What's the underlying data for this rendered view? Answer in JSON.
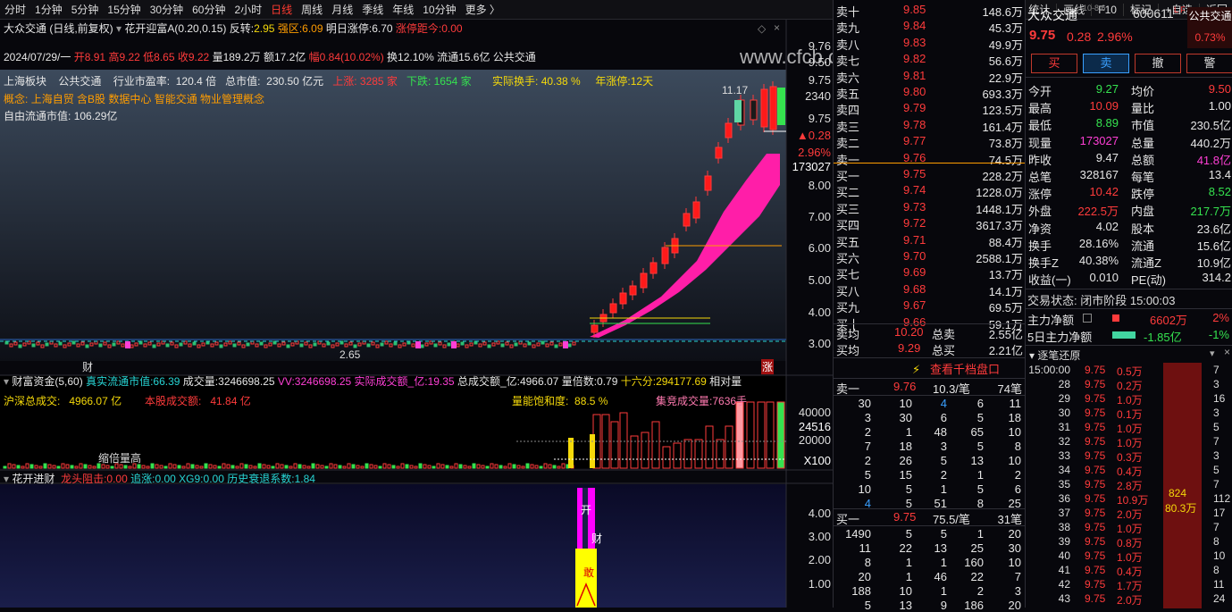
{
  "toolbar": {
    "periods": [
      "分时",
      "1分钟",
      "5分钟",
      "15分钟",
      "30分钟",
      "60分钟",
      "2小时",
      "日线",
      "周线",
      "月线",
      "季线",
      "年线",
      "10分钟",
      "更多 〉"
    ],
    "active_period": "日线",
    "right": [
      "复权",
      "叠加",
      "多股",
      "统计",
      "画线",
      "F10",
      "标记",
      "+自选",
      "返回"
    ]
  },
  "chart": {
    "title": "大众交通 (日线,前复权)",
    "indicator": "花开迎富A(0.20,0.15)",
    "fanzhuan_label": "反转:",
    "fanzhuan": "2.95",
    "qiangqu_label": "强区:",
    "qiangqu": "6.09",
    "mingri_label": "明日涨停:",
    "mingri": "6.70",
    "juli_label": "涨停距今:",
    "juli": "0.00",
    "date": "2024/07/29/一",
    "kai": "开8.91",
    "gao": "高9.22",
    "di": "低8.65",
    "shou": "收9.22",
    "liang": "量189.2万",
    "e": "额17.2亿",
    "fu": "幅0.84(10.02%)",
    "huan": "换12.10%",
    "liutong": "流通15.6亿",
    "name_tag": "公共交通",
    "board": "上海板块",
    "industry": "公共交通",
    "pe_label": "行业市盈率:",
    "pe": "120.4 倍",
    "mcap_label": "总市值:",
    "mcap": "230.50 亿元",
    "up_label": "上涨:",
    "up": "3285 家",
    "down_label": "下跌:",
    "down": "1654 家",
    "turn_label": "实际换手:",
    "turn": "40.38 %",
    "nian_label": "年涨停:",
    "nian": "12天",
    "concept_label": "概念:",
    "concepts": "上海自贸  含B股  数据中心  智能交通  物业管理概念",
    "free_label": "自由流通市值:",
    "free": "106.29亿",
    "watermark": "www.cfcb.com",
    "yticks": [
      "9.76",
      "9.50",
      "9.75",
      "2340",
      "9.75",
      "▲0.28",
      "2.96%",
      "173027",
      "8.00",
      "7.00",
      "6.00",
      "5.00",
      "4.00",
      "3.00"
    ],
    "high_label": "11.17",
    "low_label": "2.65",
    "cai": "财",
    "zhang": "涨"
  },
  "vol": {
    "title": "财富资金(5,60)",
    "zhenshi_label": "真实流通市值:",
    "zhenshi": "66.39",
    "cjl_label": "成交量:",
    "cjl": "3246698.25",
    "vv_label": "VV:",
    "vv": "3246698.25",
    "sjcje_label": "实际成交额_亿:",
    "sjcje": "19.35",
    "zcje_label": "总成交额_亿:",
    "zcje": "4966.07",
    "lbs_label": "量倍数:",
    "lbs": "0.79",
    "sl_label": "十六分:",
    "sl": "294177.69",
    "xd_label": "相对量",
    "hs_label": "沪深总成交:",
    "hs": "4966.07 亿",
    "bg_label": "本股成交额:",
    "bg": "41.84 亿",
    "bh_label": "量能饱和度:",
    "bh": "88.5 %",
    "jj_label": "集竞成交量:",
    "jj": "7636手",
    "yticks": [
      "40000",
      "24516",
      "20000",
      "X100"
    ],
    "suo": "缩倍量高"
  },
  "sub": {
    "title": "花开进财",
    "lt_label": "龙头阻击:",
    "lt": "0.00",
    "zz_label": "追涨:",
    "zz": "0.00",
    "xg_label": "XG9:",
    "xg": "0.00",
    "ls_label": "历史衰退系数:",
    "ls": "1.84",
    "yticks": [
      "4.00",
      "3.00",
      "2.00",
      "1.00"
    ],
    "kai": "开",
    "cai": "财",
    "gan": "敢"
  },
  "quote": {
    "sells": [
      {
        "label": "卖十",
        "price": "9.85",
        "vol": "148.6万"
      },
      {
        "label": "卖九",
        "price": "9.84",
        "vol": "45.3万"
      },
      {
        "label": "卖八",
        "price": "9.83",
        "vol": "49.9万"
      },
      {
        "label": "卖七",
        "price": "9.82",
        "vol": "56.6万"
      },
      {
        "label": "卖六",
        "price": "9.81",
        "vol": "22.9万"
      },
      {
        "label": "卖五",
        "price": "9.80",
        "vol": "693.3万"
      },
      {
        "label": "卖四",
        "price": "9.79",
        "vol": "123.5万"
      },
      {
        "label": "卖三",
        "price": "9.78",
        "vol": "161.4万"
      },
      {
        "label": "卖二",
        "price": "9.77",
        "vol": "73.8万"
      },
      {
        "label": "卖一",
        "price": "9.76",
        "vol": "74.5万"
      }
    ],
    "buys": [
      {
        "label": "买一",
        "price": "9.75",
        "vol": "228.2万"
      },
      {
        "label": "买二",
        "price": "9.74",
        "vol": "1228.0万"
      },
      {
        "label": "买三",
        "price": "9.73",
        "vol": "1448.1万"
      },
      {
        "label": "买四",
        "price": "9.72",
        "vol": "3617.3万"
      },
      {
        "label": "买五",
        "price": "9.71",
        "vol": "88.4万"
      },
      {
        "label": "买六",
        "price": "9.70",
        "vol": "2588.1万"
      },
      {
        "label": "买七",
        "price": "9.69",
        "vol": "13.7万"
      },
      {
        "label": "买八",
        "price": "9.68",
        "vol": "14.1万"
      },
      {
        "label": "买九",
        "price": "9.67",
        "vol": "69.5万"
      },
      {
        "label": "买十",
        "price": "9.66",
        "vol": "59.1万"
      }
    ],
    "sell_avg_label": "卖均",
    "sell_avg": "10.20",
    "total_sell_label": "总卖",
    "total_sell": "2.55亿",
    "buy_avg_label": "买均",
    "buy_avg": "9.29",
    "total_buy_label": "总买",
    "total_buy": "2.21亿",
    "qiandang": "查看千档盘口",
    "sell1_label": "卖一",
    "sell1_price": "9.76",
    "sell1_per": "10.3/笔",
    "sell1_n": "74笔",
    "sell1_grid": [
      [
        "30",
        "10",
        "4",
        "6",
        "11"
      ],
      [
        "3",
        "30",
        "6",
        "5",
        "18"
      ],
      [
        "2",
        "1",
        "48",
        "65",
        "10"
      ],
      [
        "7",
        "18",
        "3",
        "5",
        "8"
      ],
      [
        "2",
        "26",
        "5",
        "13",
        "10"
      ],
      [
        "5",
        "15",
        "2",
        "1",
        "2"
      ],
      [
        "10",
        "5",
        "1",
        "5",
        "6"
      ],
      [
        "4",
        "5",
        "51",
        "8",
        "25"
      ]
    ],
    "buy1_label": "买一",
    "buy1_price": "9.75",
    "buy1_per": "75.5/笔",
    "buy1_n": "31笔",
    "buy1_grid": [
      [
        "1490",
        "5",
        "5",
        "1",
        "20"
      ],
      [
        "11",
        "22",
        "13",
        "25",
        "30"
      ],
      [
        "8",
        "1",
        "1",
        "160",
        "10"
      ],
      [
        "20",
        "1",
        "46",
        "22",
        "7"
      ],
      [
        "188",
        "10",
        "1",
        "2",
        "3"
      ],
      [
        "5",
        "13",
        "9",
        "186",
        "20"
      ]
    ]
  },
  "info": {
    "name": "大众交通",
    "code": "600611",
    "tag": "公共交通",
    "mini": "10-8.6",
    "price": "9.75",
    "change": "0.28",
    "pct": "2.96%",
    "ratio": "0.73%",
    "buttons": [
      "买",
      "卖",
      "撤",
      "警"
    ],
    "rows": [
      {
        "l1": "今开",
        "v1": "9.27",
        "l2": "均价",
        "v2": "9.50"
      },
      {
        "l1": "最高",
        "v1": "10.09",
        "l2": "量比",
        "v2": "1.00"
      },
      {
        "l1": "最低",
        "v1": "8.89",
        "l2": "市值",
        "v2": "230.5亿"
      },
      {
        "l1": "现量",
        "v1": "173027",
        "l2": "总量",
        "v2": "440.2万"
      },
      {
        "l1": "昨收",
        "v1": "9.47",
        "l2": "总额",
        "v2": "41.8亿"
      },
      {
        "l1": "总笔",
        "v1": "328167",
        "l2": "每笔",
        "v2": "13.4"
      },
      {
        "l1": "涨停",
        "v1": "10.42",
        "l2": "跌停",
        "v2": "8.52"
      },
      {
        "l1": "外盘",
        "v1": "222.5万",
        "l2": "内盘",
        "v2": "217.7万"
      },
      {
        "l1": "净资",
        "v1": "4.02",
        "l2": "股本",
        "v2": "23.6亿"
      },
      {
        "l1": "换手",
        "v1": "28.16%",
        "l2": "流通",
        "v2": "15.6亿"
      },
      {
        "l1": "换手Z",
        "v1": "40.38%",
        "l2": "流通Z",
        "v2": "10.9亿"
      },
      {
        "l1": "收益(一)",
        "v1": "0.010",
        "l2": "PE(动)",
        "v2": "314.2"
      }
    ],
    "status": "交易状态: 闭市阶段 15:00:03",
    "zl_label": "主力净额",
    "zl": "6602万",
    "zl_pct": "2%",
    "zl5_label": "5日主力净额",
    "zl5": "-1.85亿",
    "zl5_pct": "-1%"
  },
  "tick": {
    "title": "逐笔还原",
    "rows": [
      {
        "t": "15:00:00",
        "p": "9.75",
        "v": "0.5万",
        "r": "7"
      },
      {
        "t": "28",
        "p": "9.75",
        "v": "0.2万",
        "r": "3"
      },
      {
        "t": "29",
        "p": "9.75",
        "v": "1.0万",
        "r": "16"
      },
      {
        "t": "30",
        "p": "9.75",
        "v": "0.1万",
        "r": "3"
      },
      {
        "t": "31",
        "p": "9.75",
        "v": "1.0万",
        "r": "5"
      },
      {
        "t": "32",
        "p": "9.75",
        "v": "1.0万",
        "r": "7"
      },
      {
        "t": "33",
        "p": "9.75",
        "v": "0.3万",
        "r": "3"
      },
      {
        "t": "34",
        "p": "9.75",
        "v": "0.4万",
        "r": "5"
      },
      {
        "t": "35",
        "p": "9.75",
        "v": "2.8万",
        "r": "7"
      },
      {
        "t": "36",
        "p": "9.75",
        "v": "10.9万",
        "r": "112"
      },
      {
        "t": "37",
        "p": "9.75",
        "v": "2.0万",
        "r": "17"
      },
      {
        "t": "38",
        "p": "9.75",
        "v": "1.0万",
        "r": "7"
      },
      {
        "t": "39",
        "p": "9.75",
        "v": "0.8万",
        "r": "8"
      },
      {
        "t": "40",
        "p": "9.75",
        "v": "1.0万",
        "r": "10"
      },
      {
        "t": "41",
        "p": "9.75",
        "v": "0.4万",
        "r": "8"
      },
      {
        "t": "42",
        "p": "9.75",
        "v": "1.7万",
        "r": "11"
      },
      {
        "t": "43",
        "p": "9.75",
        "v": "2.0万",
        "r": "24"
      }
    ],
    "bar_n": "824",
    "bar_v": "80.3万"
  }
}
